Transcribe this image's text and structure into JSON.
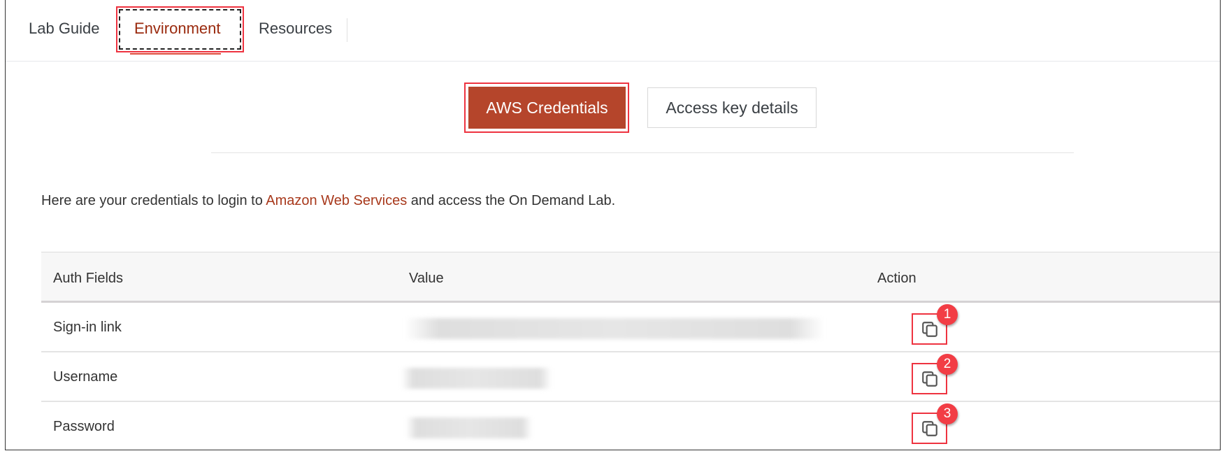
{
  "tabs": [
    {
      "label": "Lab Guide"
    },
    {
      "label": "Environment",
      "active": true
    },
    {
      "label": "Resources"
    }
  ],
  "subtabs": {
    "aws_credentials": "AWS Credentials",
    "access_key_details": "Access key details"
  },
  "intro": {
    "prefix": "Here are your credentials to login to ",
    "link": "Amazon Web Services",
    "suffix": " and access the On Demand Lab."
  },
  "table": {
    "headers": [
      "Auth Fields",
      "Value",
      "Action"
    ],
    "rows": [
      {
        "field": "Sign-in link",
        "badge": "1"
      },
      {
        "field": "Username",
        "badge": "2"
      },
      {
        "field": "Password",
        "badge": "3"
      }
    ]
  },
  "colors": {
    "accent": "#b5452b",
    "highlight": "#ee3340",
    "active_tab": "#9a2a0e"
  }
}
